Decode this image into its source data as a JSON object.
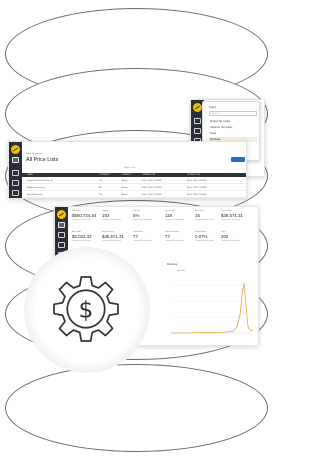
{
  "dropdown": {
    "header": "Types",
    "search_placeholder": "Search...",
    "options": [
      "Product Tax Codes",
      "Customer Tax Codes",
      "Taxes",
      "Tax Rules",
      "Tax Jurisdictions"
    ],
    "selected_index": 3
  },
  "price_lists": {
    "breadcrumb": "Sales / Price List",
    "title": "All Price Lists",
    "columns": [
      "NAME",
      "CURRENCY",
      "DEFAULT",
      "CREATED ON",
      "UPDATED ON"
    ],
    "rows": [
      {
        "name": "Veterans & Seniors Price List",
        "currency": "Yes",
        "default": "Active",
        "created": "Feb 1, 2022, 1:36 PM",
        "updated": "Feb 1, 2022, 1:36 PM"
      },
      {
        "name": "Wholesale Price List",
        "currency": "No",
        "default": "Active",
        "created": "Feb 1, 2022, 1:36 PM",
        "updated": "Feb 1, 2022, 1:36 PM"
      },
      {
        "name": "Default Price List",
        "currency": "Yes",
        "default": "Active",
        "created": "Feb 1, 2022, 1:36 PM",
        "updated": "Feb 1, 2022, 1:36 PM"
      }
    ],
    "pager": "Page 1 of 1"
  },
  "metrics": {
    "row1": [
      {
        "label": "Net Sales",
        "value": "$500,724.54",
        "sub": "Compared to last month"
      },
      {
        "label": "Orders",
        "value": "183",
        "sub": "Compared to last month"
      },
      {
        "label": "Returns",
        "value": "5%",
        "sub": "Compared to last month"
      },
      {
        "label": "Items Sold",
        "value": "118",
        "sub": "Compared to last month"
      },
      {
        "label": "Net Profit",
        "value": "15",
        "sub": "Compared to last month"
      },
      {
        "label": "Gross Sales",
        "value": "$36,571.31",
        "sub": "Compared to last month"
      }
    ],
    "row2": [
      {
        "label": "Avg Order",
        "value": "$2,032.32",
        "sub": "Compared to last month"
      },
      {
        "label": "Avg Discount",
        "value": "$36,571.31",
        "sub": "Compared to last month"
      },
      {
        "label": "Customers",
        "value": "77",
        "sub": "Compared to last month"
      },
      {
        "label": "New Customers",
        "value": "77",
        "sub": "Compared to last month"
      },
      {
        "label": "Refund Rate",
        "value": "0.07%",
        "sub": "Compared to last month"
      },
      {
        "label": "Visits",
        "value": "202",
        "sub": "Compared to last month"
      }
    ],
    "chart_title": "Revenue",
    "chart_legend": "Net Sales"
  },
  "colors": {
    "accent": "#f2c200",
    "rail": "#2b2f35",
    "primary_button": "#1f6fd1"
  },
  "icons": {
    "center": "dollar-gear-icon"
  }
}
